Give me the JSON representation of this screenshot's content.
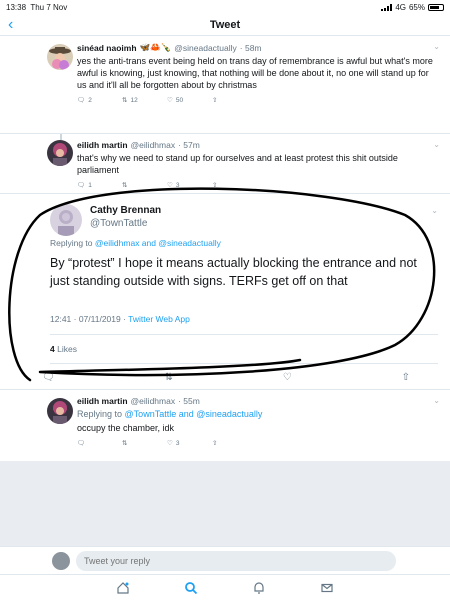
{
  "status_bar": {
    "time": "13:38",
    "date": "Thu 7 Nov",
    "network": "4G",
    "battery": "65%"
  },
  "nav": {
    "title": "Tweet"
  },
  "thread": [
    {
      "name": "sinéad naoimh",
      "emoji": "🦋🦀🍾",
      "handle": "@sineadactually",
      "time": "· 58m",
      "text": "yes the anti-trans event being held on trans day of remembrance is awful but what's more awful is knowing, just knowing, that nothing will be done about it, no one will stand up for us and it'll all be forgotten about by christmas",
      "replies": "2",
      "retweets": "12",
      "likes": "50"
    },
    {
      "name": "eilidh martin",
      "handle": "@eilidhmax",
      "time": "· 57m",
      "text": "that's why we need to stand up for ourselves and at least protest this shit outside parliament",
      "replies": "1",
      "retweets": "",
      "likes": "3"
    }
  ],
  "main_tweet": {
    "name": "Cathy Brennan",
    "handle": "@TownTattle",
    "replying_prefix": "Replying to",
    "replying_to": "@eilidhmax and @sineadactually",
    "text": "By “protest” I hope it means actually blocking the entrance and not just standing outside with signs. TERFs get off on that",
    "timestamp": "12:41 · 07/11/2019 ·",
    "source": "Twitter Web App",
    "likes_count": "4",
    "likes_label": "Likes"
  },
  "reply": {
    "name": "eilidh martin",
    "handle": "@eilidhmax",
    "time": "· 55m",
    "replying_prefix": "Replying to",
    "replying_to": "@TownTattle and @sineadactually",
    "text": "occupy the chamber, idk",
    "likes": "3"
  },
  "compose": {
    "placeholder": "Tweet your reply"
  },
  "colors": {
    "accent": "#1da1f2",
    "secondary_text": "#657786",
    "annotation": "#000000"
  }
}
